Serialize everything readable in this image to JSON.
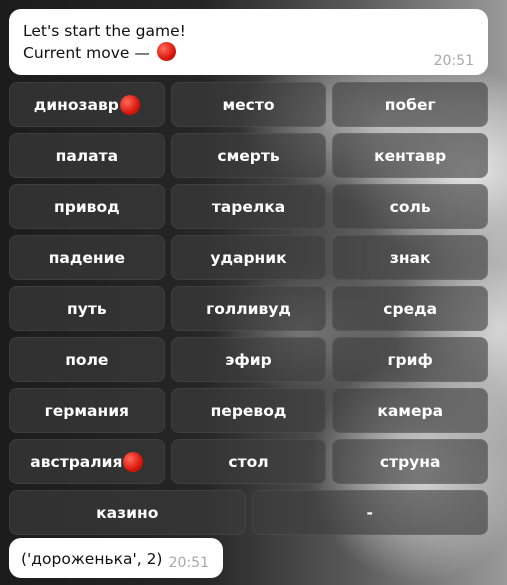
{
  "messages": {
    "top": {
      "line1": "Let's start the game!",
      "line2_prefix": "Current move — ",
      "time": "20:51"
    },
    "bottom": {
      "text": "('дороженька', 2)",
      "time": "20:51"
    }
  },
  "keyboard": {
    "rows": [
      [
        "динозавр",
        "место",
        "побег"
      ],
      [
        "палата",
        "смерть",
        "кентавр"
      ],
      [
        "привод",
        "тарелка",
        "соль"
      ],
      [
        "падение",
        "ударник",
        "знак"
      ],
      [
        "путь",
        "голливуд",
        "среда"
      ],
      [
        "поле",
        "эфир",
        "гриф"
      ],
      [
        "германия",
        "перевод",
        "камера"
      ],
      [
        "австралия",
        "стол",
        "струна"
      ],
      [
        "казино",
        "-"
      ]
    ],
    "marked_keys": [
      "динозавр",
      "австралия"
    ]
  },
  "icons": {
    "marker": "red-circle-icon",
    "marker_color": "#d9160c"
  }
}
